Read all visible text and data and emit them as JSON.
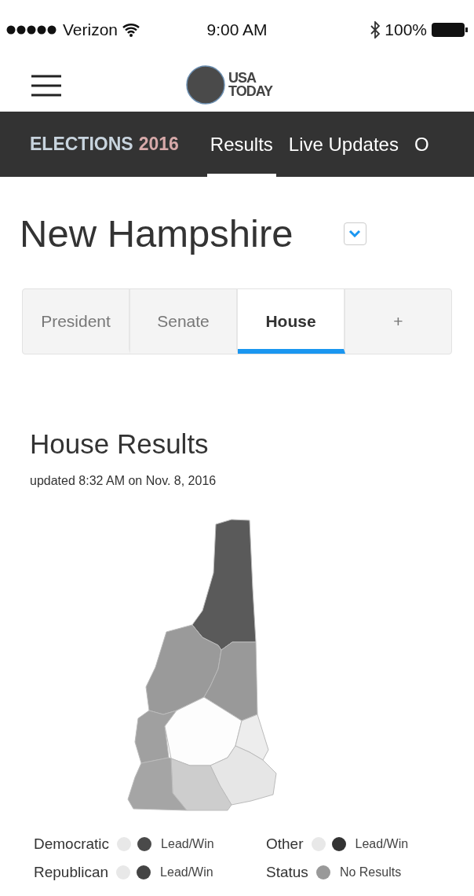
{
  "status_bar": {
    "carrier": "Verizon",
    "time": "9:00 AM",
    "battery": "100%"
  },
  "header": {
    "logo_top": "USA",
    "logo_bottom": "TODAY"
  },
  "nav": {
    "brand_word": "ELECTIONS",
    "brand_year": "2016",
    "items": [
      {
        "label": "Results",
        "selected": true
      },
      {
        "label": "Live Updates",
        "selected": false
      },
      {
        "label": "O",
        "selected": false
      }
    ]
  },
  "state": {
    "name": "New Hampshire"
  },
  "tabs": [
    {
      "label": "President",
      "selected": false
    },
    {
      "label": "Senate",
      "selected": false
    },
    {
      "label": "House",
      "selected": true
    },
    {
      "label": "+",
      "selected": false
    }
  ],
  "results": {
    "title": "House Results",
    "updated": "updated 8:32 AM on Nov. 8, 2016"
  },
  "legend": [
    {
      "party": "Democratic",
      "dots": [
        {
          "color": "#e8e8e8"
        },
        {
          "color": "#4a4a4a"
        }
      ],
      "label": "Lead/Win"
    },
    {
      "party": "Other",
      "dots": [
        {
          "color": "#e8e8e8"
        },
        {
          "color": "#333333"
        }
      ],
      "label": "Lead/Win"
    },
    {
      "party": "Republican",
      "dots": [
        {
          "color": "#e8e8e8"
        },
        {
          "color": "#444444"
        }
      ],
      "label": "Lead/Win"
    },
    {
      "party": "Status",
      "dots": [
        {
          "color": "#999999"
        }
      ],
      "label": "No Results"
    }
  ]
}
